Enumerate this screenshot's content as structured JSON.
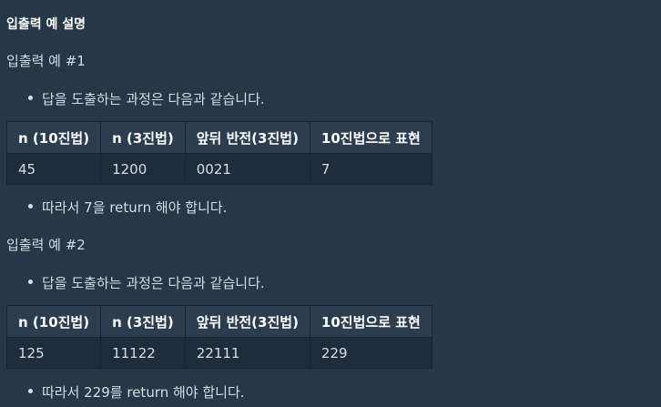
{
  "section_title": "입출력 예 설명",
  "examples": [
    {
      "title": "입출력 예 #1",
      "intro": "답을 도출하는 과정은 다음과 같습니다.",
      "headers": [
        "n (10진법)",
        "n (3진법)",
        "앞뒤 반전(3진법)",
        "10진법으로 표현"
      ],
      "row": [
        "45",
        "1200",
        "0021",
        "7"
      ],
      "conclusion": "따라서 7을 return 해야 합니다."
    },
    {
      "title": "입출력 예 #2",
      "intro": "답을 도출하는 과정은 다음과 같습니다.",
      "headers": [
        "n (10진법)",
        "n (3진법)",
        "앞뒤 반전(3진법)",
        "10진법으로 표현"
      ],
      "row": [
        "125",
        "11122",
        "22111",
        "229"
      ],
      "conclusion": "따라서 229를 return 해야 합니다."
    }
  ]
}
